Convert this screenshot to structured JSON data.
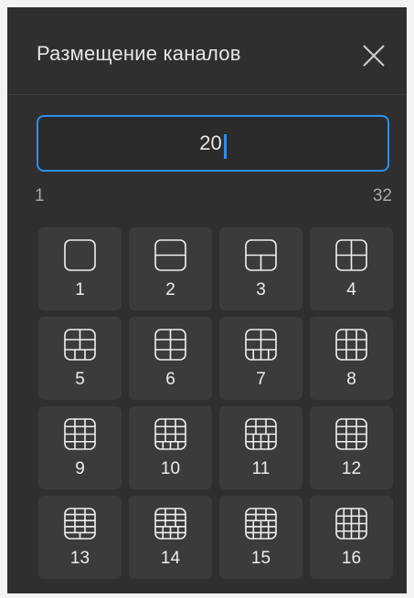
{
  "dialog": {
    "title": "Размещение каналов",
    "close_icon": "close-icon"
  },
  "count_input": {
    "value": "20",
    "min_label": "1",
    "max_label": "32"
  },
  "layouts": [
    {
      "label": "1",
      "icon": "layout-1-icon"
    },
    {
      "label": "2",
      "icon": "layout-2-icon"
    },
    {
      "label": "3",
      "icon": "layout-3-icon"
    },
    {
      "label": "4",
      "icon": "layout-4-icon"
    },
    {
      "label": "5",
      "icon": "layout-5-icon"
    },
    {
      "label": "6",
      "icon": "layout-6-icon"
    },
    {
      "label": "7",
      "icon": "layout-7-icon"
    },
    {
      "label": "8",
      "icon": "layout-8-icon"
    },
    {
      "label": "9",
      "icon": "layout-9-icon"
    },
    {
      "label": "10",
      "icon": "layout-10-icon"
    },
    {
      "label": "11",
      "icon": "layout-11-icon"
    },
    {
      "label": "12",
      "icon": "layout-12-icon"
    },
    {
      "label": "13",
      "icon": "layout-13-icon"
    },
    {
      "label": "14",
      "icon": "layout-14-icon"
    },
    {
      "label": "15",
      "icon": "layout-15-icon"
    },
    {
      "label": "16",
      "icon": "layout-16-icon"
    }
  ],
  "colors": {
    "panel_bg": "#2f2f2f",
    "tile_bg": "#3b3b3b",
    "accent": "#2e8ff0",
    "text": "#e6e6e6"
  }
}
